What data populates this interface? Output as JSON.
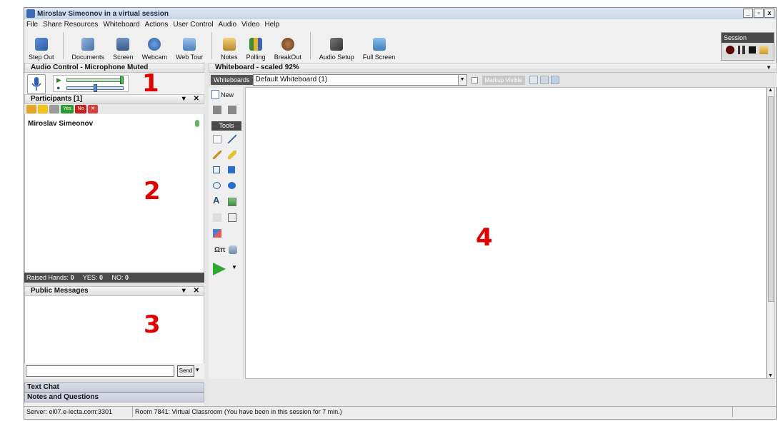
{
  "window": {
    "title": "Miroslav Simeonov in a virtual session",
    "controls": [
      "_",
      "▫",
      "x"
    ]
  },
  "menu": [
    "File",
    "Share Resources",
    "Whiteboard",
    "Actions",
    "User Control",
    "Audio",
    "Video",
    "Help"
  ],
  "toolbar": [
    {
      "label": "Step Out",
      "icon": "step-out-icon"
    },
    {
      "label": "Documents",
      "icon": "documents-icon"
    },
    {
      "label": "Screen",
      "icon": "screen-icon"
    },
    {
      "label": "Webcam",
      "icon": "webcam-icon"
    },
    {
      "label": "Web Tour",
      "icon": "web-tour-icon"
    },
    {
      "label": "Notes",
      "icon": "notes-icon"
    },
    {
      "label": "Polling",
      "icon": "polling-icon"
    },
    {
      "label": "BreakOut",
      "icon": "breakout-icon"
    },
    {
      "label": "Audio Setup",
      "icon": "audio-setup-icon"
    },
    {
      "label": "Full Screen",
      "icon": "full-screen-icon"
    }
  ],
  "recording": {
    "title": "Session Recording"
  },
  "audio": {
    "title": "Audio Control - Microphone Muted",
    "speaker_level": 1.0,
    "mic_level": 0.5
  },
  "participants": {
    "title": "Participants [1]",
    "tool_yes": "Yes",
    "tool_no": "No",
    "list": [
      {
        "name": "Miroslav Simeonov"
      }
    ],
    "raised_label": "Raised Hands:",
    "raised": "0",
    "yes_label": "YES:",
    "yes": "0",
    "no_label": "NO:",
    "no": "0"
  },
  "messages": {
    "title": "Public Messages",
    "send_label": "Send"
  },
  "collapsed": {
    "text_chat": "Text Chat",
    "notes": "Notes and Questions"
  },
  "whiteboard": {
    "title": "Whiteboard - scaled 92%",
    "tab": "Whiteboards",
    "selected": "Default Whiteboard (1)",
    "markup": "Markup Visible",
    "new_label": "New",
    "tools_label": "Tools",
    "symbols": "Ωπ"
  },
  "annotations": {
    "one": "1",
    "two": "2",
    "three": "3",
    "four": "4"
  },
  "status": {
    "server": "Server: el07.e-lecta.com:3301",
    "room": "Room 7841: Virtual Classroom (You have been in this session for 7 min.)"
  }
}
